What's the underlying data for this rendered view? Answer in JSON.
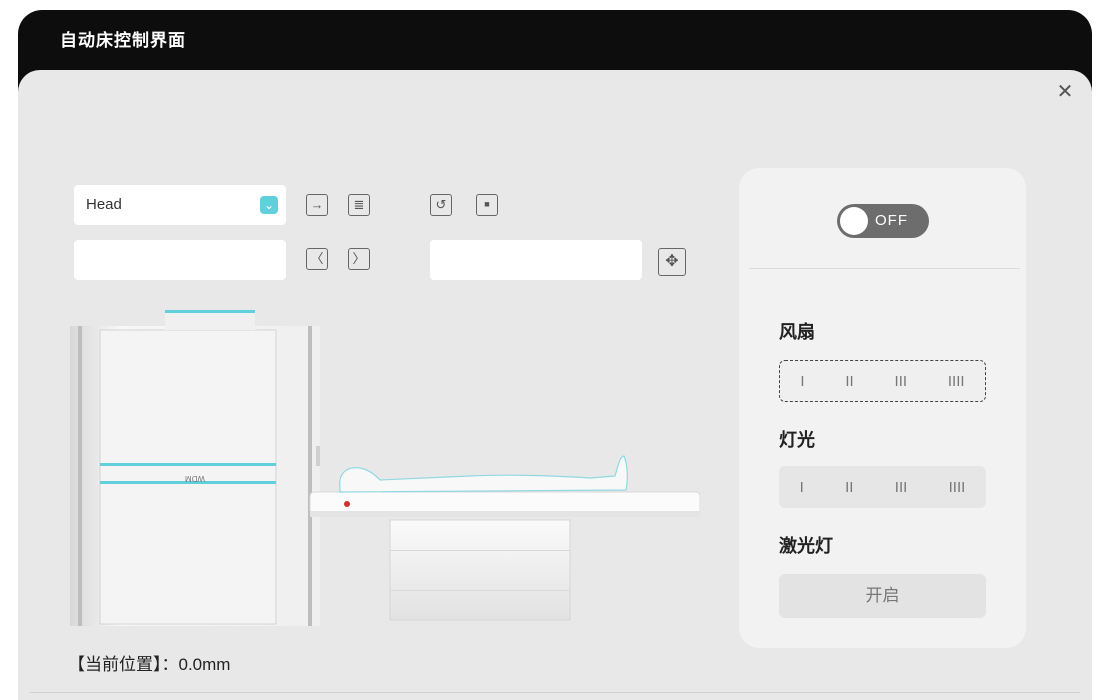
{
  "window": {
    "title": "自动床控制界面"
  },
  "controls": {
    "region_select": {
      "value": "Head"
    },
    "input_left": {
      "value": ""
    },
    "input_right": {
      "value": ""
    }
  },
  "toolbar": {
    "arrow_right": "→",
    "list": "≣",
    "undo": "↺",
    "stop": "■",
    "prev": "〈",
    "next": "〉",
    "move": "✥"
  },
  "machine": {
    "brand": "WDM"
  },
  "status": {
    "position_text": "【当前位置】：0.0mm"
  },
  "right_panel": {
    "power_toggle": {
      "label": "OFF",
      "state": "off"
    },
    "fan": {
      "title": "风扇",
      "levels": [
        "I",
        "II",
        "III",
        "IIII"
      ]
    },
    "light": {
      "title": "灯光",
      "levels": [
        "I",
        "II",
        "III",
        "IIII"
      ]
    },
    "laser": {
      "title": "激光灯",
      "button_label": "开启"
    }
  },
  "colors": {
    "accent": "#5fd0dc",
    "header": "#0d0d0d",
    "panel": "#e8e8e8"
  },
  "icons": [
    "close-icon",
    "chevron-down-icon",
    "arrow-right-icon",
    "list-icon",
    "undo-icon",
    "stop-icon",
    "chevron-left-icon",
    "chevron-right-icon",
    "move-icon"
  ]
}
